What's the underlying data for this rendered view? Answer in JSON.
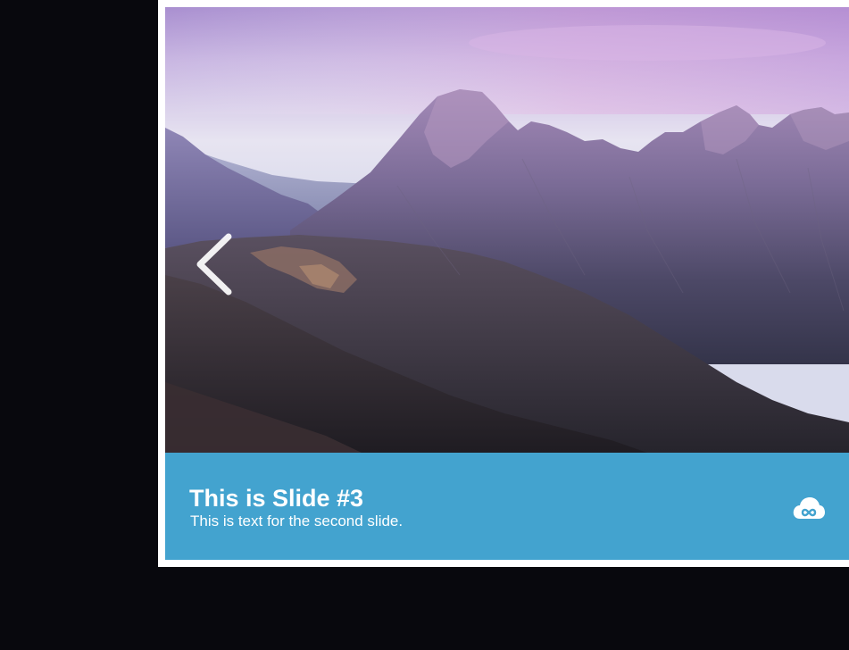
{
  "slider": {
    "current_slide": 3,
    "caption": {
      "title": "This is Slide #3",
      "text": "This is text for the second slide."
    },
    "prev_icon": "chevron-left-icon",
    "brand_icon": "cloud-infinity-icon"
  },
  "colors": {
    "page_background": "#08080d",
    "frame": "#ffffff",
    "caption_background": "#43a3cf",
    "caption_text": "#ffffff"
  }
}
